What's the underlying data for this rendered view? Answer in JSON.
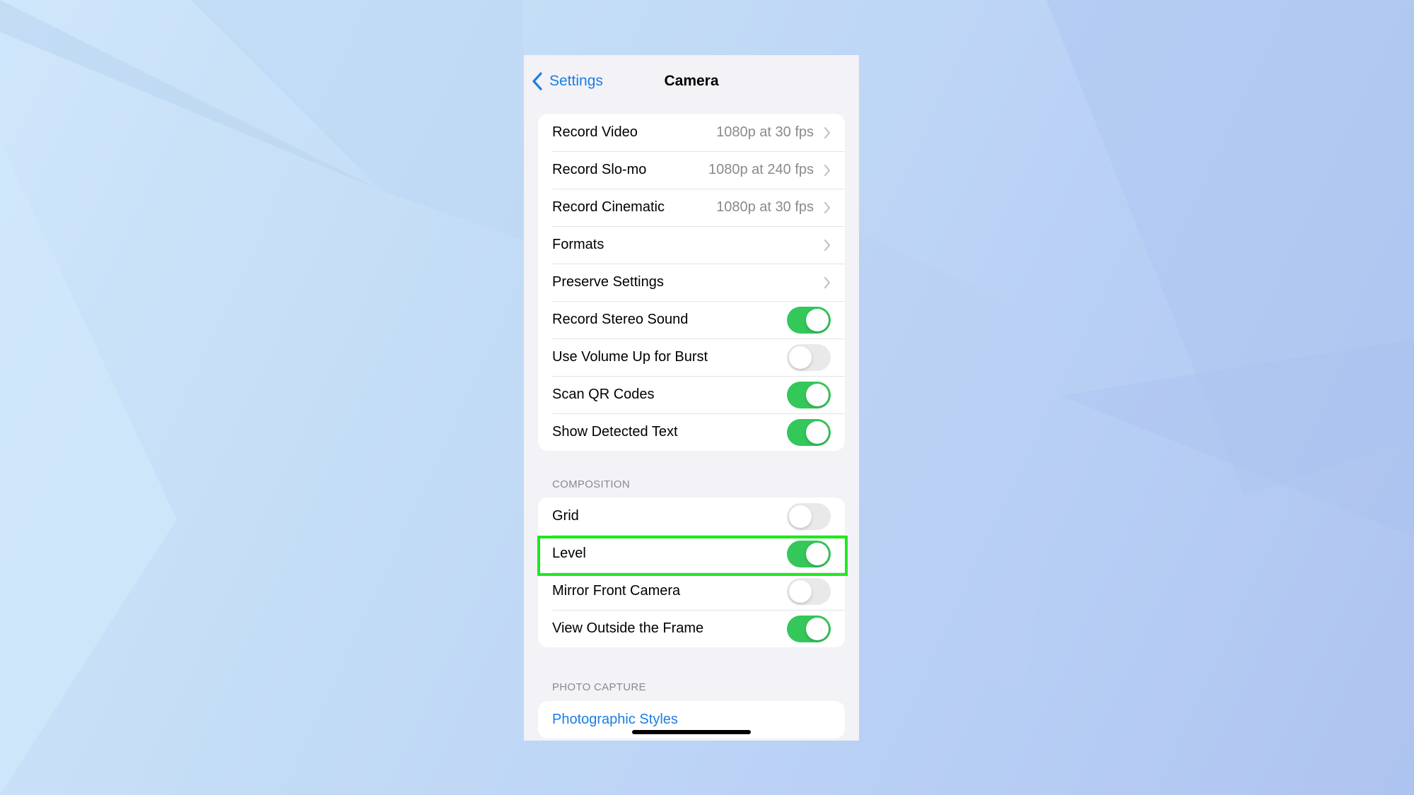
{
  "nav": {
    "back_label": "Settings",
    "title": "Camera"
  },
  "group1": [
    {
      "label": "Record Video",
      "value": "1080p at 30 fps",
      "type": "disclosure"
    },
    {
      "label": "Record Slo-mo",
      "value": "1080p at 240 fps",
      "type": "disclosure"
    },
    {
      "label": "Record Cinematic",
      "value": "1080p at 30 fps",
      "type": "disclosure"
    },
    {
      "label": "Formats",
      "value": "",
      "type": "disclosure"
    },
    {
      "label": "Preserve Settings",
      "value": "",
      "type": "disclosure"
    },
    {
      "label": "Record Stereo Sound",
      "type": "toggle",
      "on": true
    },
    {
      "label": "Use Volume Up for Burst",
      "type": "toggle",
      "on": false
    },
    {
      "label": "Scan QR Codes",
      "type": "toggle",
      "on": true
    },
    {
      "label": "Show Detected Text",
      "type": "toggle",
      "on": true
    }
  ],
  "composition": {
    "header": "COMPOSITION",
    "items": [
      {
        "label": "Grid",
        "type": "toggle",
        "on": false
      },
      {
        "label": "Level",
        "type": "toggle",
        "on": true,
        "highlighted": true
      },
      {
        "label": "Mirror Front Camera",
        "type": "toggle",
        "on": false
      },
      {
        "label": "View Outside the Frame",
        "type": "toggle",
        "on": true
      }
    ]
  },
  "photo_capture": {
    "header": "PHOTO CAPTURE",
    "items": [
      {
        "label": "Photographic Styles",
        "type": "link"
      }
    ]
  },
  "colors": {
    "accent": "#1a7ee6",
    "toggle_on": "#34c759",
    "toggle_off": "#e9e9ea",
    "highlight": "#1fe81f"
  }
}
